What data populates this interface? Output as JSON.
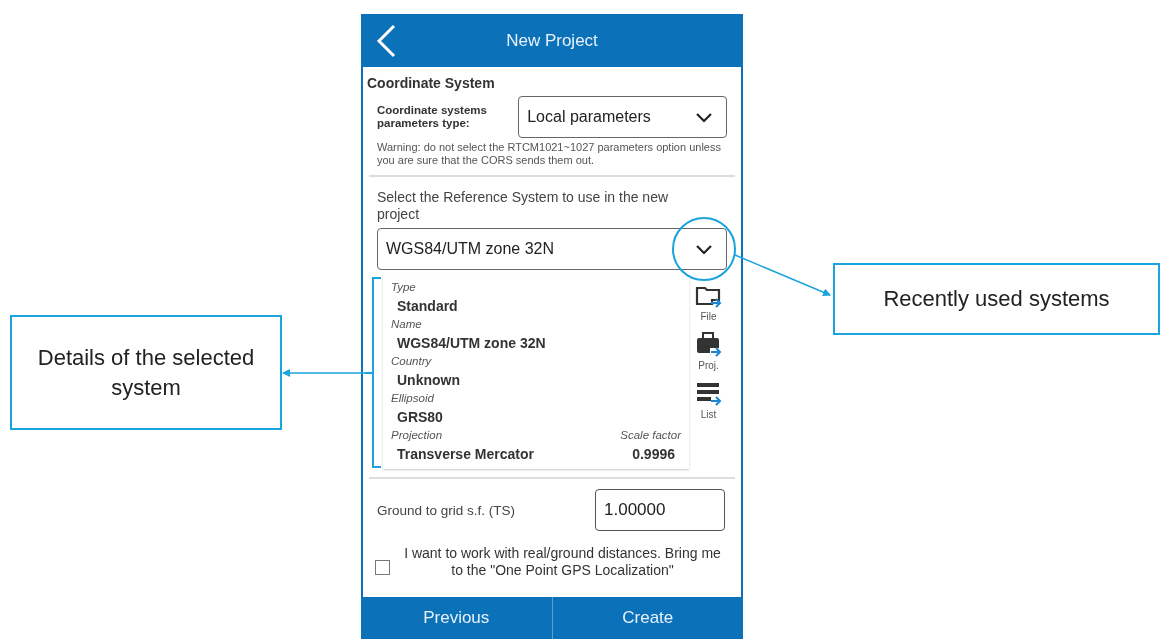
{
  "header": {
    "title": "New Project"
  },
  "section_title": "Coordinate System",
  "params_type": {
    "label": "Coordinate systems parameters type:",
    "value": "Local parameters"
  },
  "warning": "Warning: do not select the RTCM1021~1027 parameters option unless you are sure that the CORS sends them out.",
  "reference": {
    "label": "Select the Reference System to use in the new project",
    "value": "WGS84/UTM zone 32N"
  },
  "details": [
    {
      "label": "Type",
      "value": "Standard"
    },
    {
      "label": "Name",
      "value": "WGS84/UTM zone 32N"
    },
    {
      "label": "Country",
      "value": "Unknown"
    },
    {
      "label": "Ellipsoid",
      "value": "GRS80"
    },
    {
      "label": "Projection",
      "value": "Transverse Mercator",
      "extra_label": "Scale factor",
      "extra_value": "0.9996"
    }
  ],
  "side_actions": [
    {
      "kind": "file",
      "label": "File"
    },
    {
      "kind": "project",
      "label": "Proj."
    },
    {
      "kind": "list",
      "label": "List"
    }
  ],
  "ground_to_grid": {
    "label": "Ground to grid s.f. (TS)",
    "value": "1.00000"
  },
  "checkbox": {
    "label": "I want to work with real/ground distances. Bring me to the \"One Point GPS Localization\"",
    "checked": false
  },
  "buttons": [
    "Previous",
    "Create"
  ],
  "annotations": [
    {
      "kind": "right",
      "text": "Recently used systems"
    },
    {
      "kind": "left",
      "text": "Details of the selected system"
    }
  ]
}
